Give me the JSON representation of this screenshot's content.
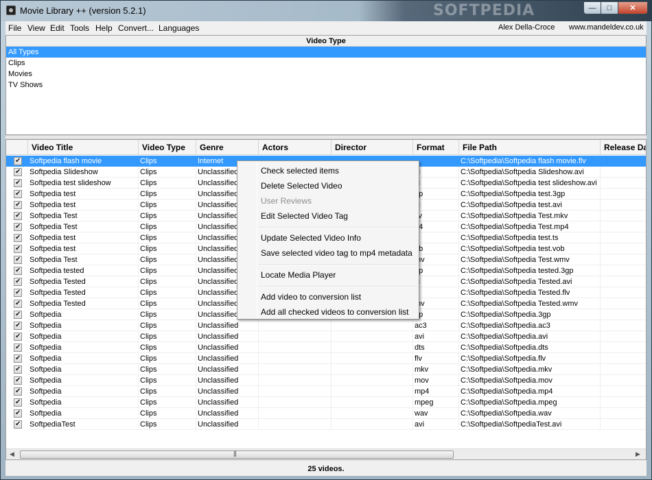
{
  "window": {
    "title": "Movie Library ++ (version 5.2.1)",
    "watermark": "SOFTPEDIA",
    "controls": {
      "minimize": "—",
      "maximize": "□",
      "close": "✕"
    }
  },
  "menu": {
    "items": [
      "File",
      "View",
      "Edit",
      "Tools",
      "Help",
      "Convert...",
      "Languages"
    ],
    "author": "Alex Della-Croce",
    "website": "www.mandeldev.co.uk"
  },
  "video_type_panel": {
    "header": "Video Type",
    "items": [
      "All Types",
      "Clips",
      "Movies",
      "TV Shows"
    ],
    "selected_index": 0
  },
  "grid": {
    "columns": [
      "Video Title",
      "Video Type",
      "Genre",
      "Actors",
      "Director",
      "Format",
      "File Path",
      "Release Da"
    ],
    "selected_row": 0,
    "rows": [
      [
        "Softpedia flash movie",
        "Clips",
        "Internet",
        "",
        "",
        "",
        "C:\\Softpedia\\Softpedia flash movie.flv"
      ],
      [
        "Softpedia Slideshow",
        "Clips",
        "Unclassified",
        "",
        "",
        "vi",
        "C:\\Softpedia\\Softpedia Slideshow.avi"
      ],
      [
        "Softpedia test slideshow",
        "Clips",
        "Unclassified",
        "",
        "",
        "vi",
        "C:\\Softpedia\\Softpedia test slideshow.avi"
      ],
      [
        "Softpedia test",
        "Clips",
        "Unclassified",
        "",
        "",
        "gp",
        "C:\\Softpedia\\Softpedia test.3gp"
      ],
      [
        "Softpedia test",
        "Clips",
        "Unclassified",
        "",
        "",
        "vi",
        "C:\\Softpedia\\Softpedia test.avi"
      ],
      [
        "Softpedia Test",
        "Clips",
        "Unclassified",
        "",
        "",
        "kv",
        "C:\\Softpedia\\Softpedia Test.mkv"
      ],
      [
        "Softpedia Test",
        "Clips",
        "Unclassified",
        "",
        "",
        "p4",
        "C:\\Softpedia\\Softpedia Test.mp4"
      ],
      [
        "Softpedia test",
        "Clips",
        "Unclassified",
        "",
        "",
        "",
        "C:\\Softpedia\\Softpedia test.ts"
      ],
      [
        "Softpedia test",
        "Clips",
        "Unclassified",
        "",
        "",
        "ob",
        "C:\\Softpedia\\Softpedia test.vob"
      ],
      [
        "Softpedia Test",
        "Clips",
        "Unclassified",
        "",
        "",
        "mv",
        "C:\\Softpedia\\Softpedia Test.wmv"
      ],
      [
        "Softpedia tested",
        "Clips",
        "Unclassified",
        "",
        "",
        "gp",
        "C:\\Softpedia\\Softpedia tested.3gp"
      ],
      [
        "Softpedia Tested",
        "Clips",
        "Unclassified",
        "",
        "",
        "vi",
        "C:\\Softpedia\\Softpedia Tested.avi"
      ],
      [
        "Softpedia Tested",
        "Clips",
        "Unclassified",
        "",
        "",
        "v",
        "C:\\Softpedia\\Softpedia Tested.flv"
      ],
      [
        "Softpedia Tested",
        "Clips",
        "Unclassified",
        "",
        "",
        "mv",
        "C:\\Softpedia\\Softpedia Tested.wmv"
      ],
      [
        "Softpedia",
        "Clips",
        "Unclassified",
        "",
        "",
        "gp",
        "C:\\Softpedia\\Softpedia.3gp"
      ],
      [
        "Softpedia",
        "Clips",
        "Unclassified",
        "",
        "",
        "ac3",
        "C:\\Softpedia\\Softpedia.ac3"
      ],
      [
        "Softpedia",
        "Clips",
        "Unclassified",
        "",
        "",
        "avi",
        "C:\\Softpedia\\Softpedia.avi"
      ],
      [
        "Softpedia",
        "Clips",
        "Unclassified",
        "",
        "",
        "dts",
        "C:\\Softpedia\\Softpedia.dts"
      ],
      [
        "Softpedia",
        "Clips",
        "Unclassified",
        "",
        "",
        "flv",
        "C:\\Softpedia\\Softpedia.flv"
      ],
      [
        "Softpedia",
        "Clips",
        "Unclassified",
        "",
        "",
        "mkv",
        "C:\\Softpedia\\Softpedia.mkv"
      ],
      [
        "Softpedia",
        "Clips",
        "Unclassified",
        "",
        "",
        "mov",
        "C:\\Softpedia\\Softpedia.mov"
      ],
      [
        "Softpedia",
        "Clips",
        "Unclassified",
        "",
        "",
        "mp4",
        "C:\\Softpedia\\Softpedia.mp4"
      ],
      [
        "Softpedia",
        "Clips",
        "Unclassified",
        "",
        "",
        "mpeg",
        "C:\\Softpedia\\Softpedia.mpeg"
      ],
      [
        "Softpedia",
        "Clips",
        "Unclassified",
        "",
        "",
        "wav",
        "C:\\Softpedia\\Softpedia.wav"
      ],
      [
        "SoftpediaTest",
        "Clips",
        "Unclassified",
        "",
        "",
        "avi",
        "C:\\Softpedia\\SoftpediaTest.avi"
      ]
    ]
  },
  "scrollbar": {
    "left_arrow": "◀",
    "right_arrow": "▶",
    "grip": "|||"
  },
  "status": "25 videos.",
  "context_menu": {
    "items": [
      {
        "label": "Check selected items",
        "enabled": true
      },
      {
        "label": "Delete Selected Video",
        "enabled": true
      },
      {
        "label": "User Reviews",
        "enabled": false
      },
      {
        "label": "Edit Selected Video Tag",
        "enabled": true
      },
      {
        "label": "Update Selected Video Info",
        "enabled": true
      },
      {
        "label": "Save selected video tag to mp4 metadata",
        "enabled": true
      },
      {
        "label": "Locate Media Player",
        "enabled": true
      },
      {
        "label": "Add video to conversion list",
        "enabled": true
      },
      {
        "label": "Add all checked videos to conversion list",
        "enabled": true
      }
    ]
  },
  "colors": {
    "selection": "#3399ff"
  }
}
